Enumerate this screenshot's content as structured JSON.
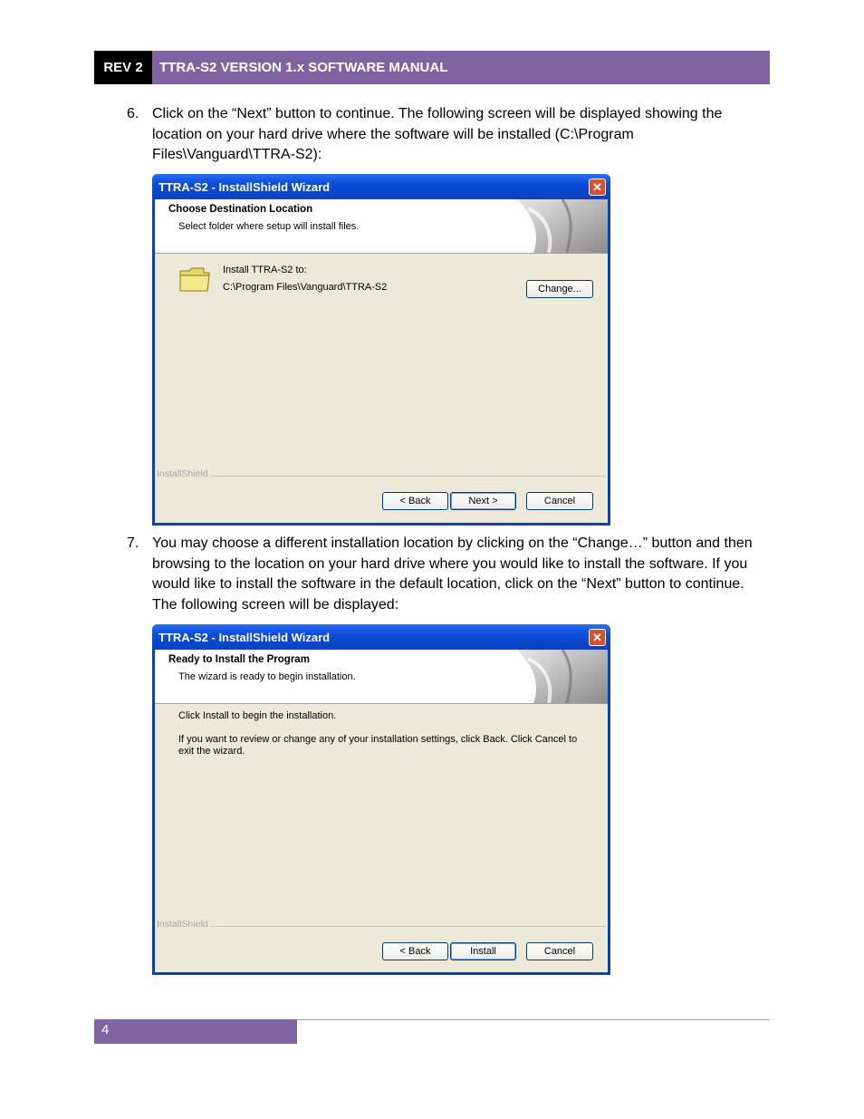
{
  "header": {
    "rev": "REV 2",
    "title": "TTRA-S2 VERSION 1.x SOFTWARE MANUAL"
  },
  "steps": [
    {
      "num": "6.",
      "text": "Click on the “Next” button to continue. The following screen will be displayed showing the location on your hard drive where the software will be installed (C:\\Program Files\\Vanguard\\TTRA-S2):"
    },
    {
      "num": "7.",
      "text": "You may choose a different installation location by clicking on the “Change…” button and then browsing to the location on your hard drive where you would like to install the software. If you would like to install the software in the default location, click on the “Next” button to continue. The following screen will be displayed:"
    }
  ],
  "dialog1": {
    "title": "TTRA-S2 - InstallShield Wizard",
    "close": "✕",
    "heading": "Choose Destination Location",
    "subheading": "Select folder where setup will install files.",
    "install_label": "Install TTRA-S2 to:",
    "install_path": "C:\\Program Files\\Vanguard\\TTRA-S2",
    "change_button": "Change...",
    "brand": "InstallShield",
    "back_button": "< Back",
    "next_button": "Next >",
    "cancel_button": "Cancel"
  },
  "dialog2": {
    "title": "TTRA-S2 - InstallShield Wizard",
    "close": "✕",
    "heading": "Ready to Install the Program",
    "subheading": "The wizard is ready to begin installation.",
    "line1": "Click Install to begin the installation.",
    "line2": "If you want to review or change any of your installation settings, click Back. Click Cancel to exit the wizard.",
    "brand": "InstallShield",
    "back_button": "< Back",
    "install_button": "Install",
    "cancel_button": "Cancel"
  },
  "footer": {
    "page": "4"
  }
}
